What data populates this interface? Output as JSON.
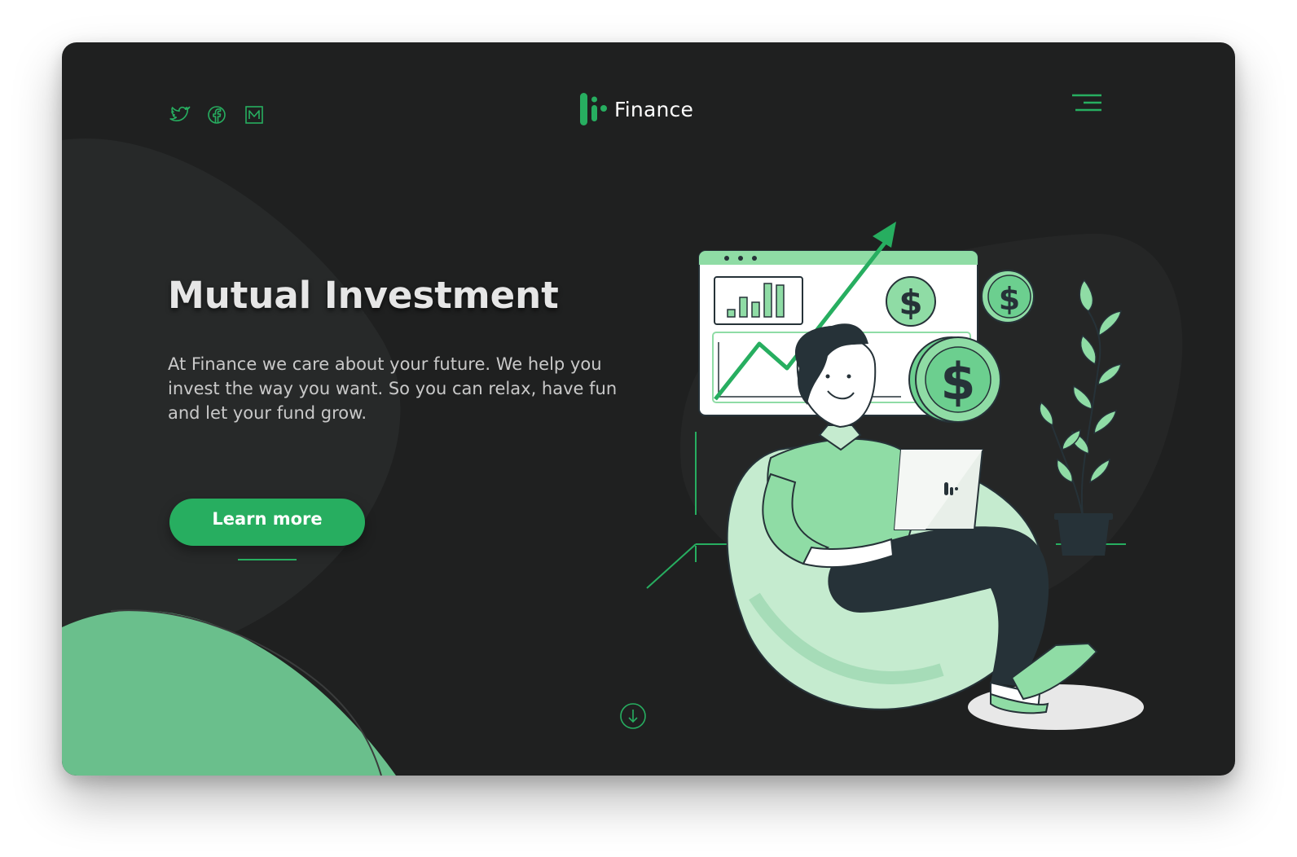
{
  "brand": {
    "name": "Finance",
    "logo_icon": "finance-logo-icon"
  },
  "header": {
    "social_icons": [
      "twitter-icon",
      "facebook-icon",
      "medium-icon"
    ],
    "menu_icon": "hamburger-menu-icon"
  },
  "hero": {
    "title": "Mutual Investment",
    "description": "At Finance we care about your future. We help you invest the way you want. So you can relax, have fun and let your fund grow.",
    "cta_label": "Learn more"
  },
  "scroll_icon": "arrow-down-circle-icon",
  "colors": {
    "background": "#1f2020",
    "accent": "#27ae60",
    "accent_light": "#8fdca5",
    "accent_pale": "#c5ebcf",
    "dark_ink": "#263238",
    "text_light": "#e6e6e6",
    "text_muted": "#c9c9c9"
  },
  "illustration": {
    "name": "investor-illustration",
    "laptop_logo": "finance-logo-icon"
  }
}
